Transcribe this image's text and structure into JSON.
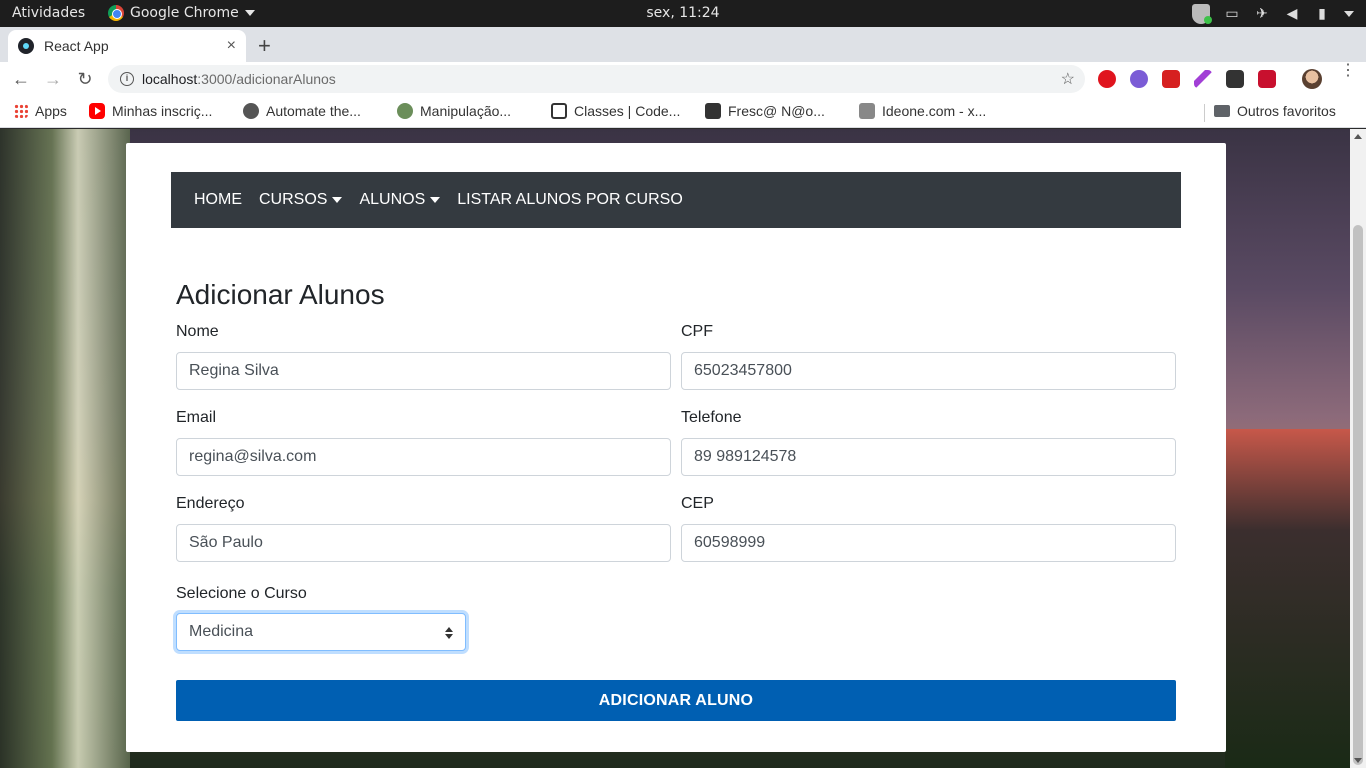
{
  "os": {
    "activities": "Atividades",
    "app_name": "Google Chrome",
    "clock": "sex, 11:24"
  },
  "browser": {
    "tab_title": "React App",
    "tab_close": "×",
    "new_tab": "+",
    "url_host": "localhost",
    "url_path": ":3000/adicionarAlunos",
    "bookmarks": [
      {
        "label": "Apps"
      },
      {
        "label": "Minhas inscriç..."
      },
      {
        "label": "Automate the..."
      },
      {
        "label": "Manipulação..."
      },
      {
        "label": "Classes | Code..."
      },
      {
        "label": "Fresc@ N@o..."
      },
      {
        "label": "Ideone.com - x..."
      }
    ],
    "other_bookmarks": "Outros favoritos"
  },
  "navbar": {
    "home": "HOME",
    "cursos": "CURSOS",
    "alunos": "ALUNOS",
    "listar": "LISTAR ALUNOS POR CURSO"
  },
  "form": {
    "title": "Adicionar Alunos",
    "nome_label": "Nome",
    "nome_value": "Regina Silva",
    "cpf_label": "CPF",
    "cpf_value": "65023457800",
    "email_label": "Email",
    "email_value": "regina@silva.com",
    "telefone_label": "Telefone",
    "telefone_value": "89 989124578",
    "endereco_label": "Endereço",
    "endereco_value": "São Paulo",
    "cep_label": "CEP",
    "cep_value": "60598999",
    "curso_label": "Selecione o Curso",
    "curso_value": "Medicina",
    "submit_label": "ADICIONAR ALUNO"
  }
}
